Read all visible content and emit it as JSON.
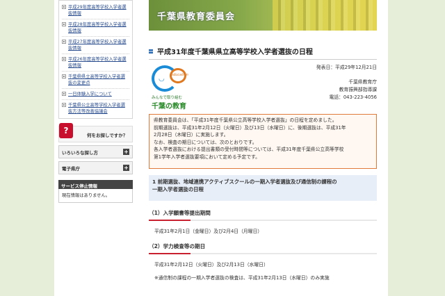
{
  "sidebar": {
    "links": [
      {
        "label": "平成29年度高等学校入学者選抜情報"
      },
      {
        "label": "平成28年度高等学校入学者選抜情報"
      },
      {
        "label": "平成27年度高等学校入学者選抜情報"
      },
      {
        "label": "平成26年度高等学校入学者選抜情報"
      },
      {
        "label": "千葉県県立高等学校入学者選抜の変更点"
      },
      {
        "label": "一日体験入学について"
      },
      {
        "label": "千葉県公立高等学校入学者選抜方法等改善協議会"
      }
    ],
    "search_prompt": "何をお探しですか？",
    "search_icon_glyph": "?",
    "nav": [
      {
        "label": "いろいろな探し方"
      },
      {
        "label": "電子県庁"
      }
    ],
    "nav_plus_glyph": "+",
    "service_heading": "サービス停止情報",
    "service_body": "現在情報はありません。"
  },
  "banner": {
    "title": "千葉県教育委員会"
  },
  "page_title": "平成31年度千葉県県立高等学校入学者選抜の日程",
  "logo": {
    "tagline": "みんなで取り組む",
    "name": "千葉の教育",
    "edu_text": "education",
    "accent_blue": "#1a8bd6",
    "accent_orange": "#e07820"
  },
  "meta": {
    "published": "発表日：平成29年12月21日",
    "org": "千葉県教育庁",
    "dept": "教育振興部指導課",
    "phone": "電話：043-223-4056"
  },
  "notice": {
    "lines": [
      "県教育委員会は、「平成31年度千葉県公立高等学校入学者選抜」の日程を定めました。",
      "前期選抜は、平成31年2月12日（火曜日）及び13日（水曜日）に、後期選抜は、平成31年",
      "2月28日（木曜日）に実施します。",
      "なお、検査の期日については、次のとおりです。",
      "各入学者選抜における提出書類の受付時間等については、平成31年度千葉県公立高等学校",
      "第1学年入学者選抜要項において定める予定です。"
    ]
  },
  "section1": {
    "heading_line1": "1 前期選抜、地域連携アクティブスクールの一期入学者選抜及び通信制の課程の",
    "heading_line2": "一期入学者選抜の日程"
  },
  "sub1": {
    "heading": "（1）入学願書等提出期間",
    "body": "平成31年2月1日（金曜日）及び2月4日（月曜日）"
  },
  "sub2": {
    "heading": "（2）学力検査等の期日",
    "body": "平成31年2月12日（火曜日）及び2月13日（水曜日）",
    "note": "※通信制の課程の一期入学者選抜の検査は、平成31年2月13日（水曜日）のみ実施"
  }
}
